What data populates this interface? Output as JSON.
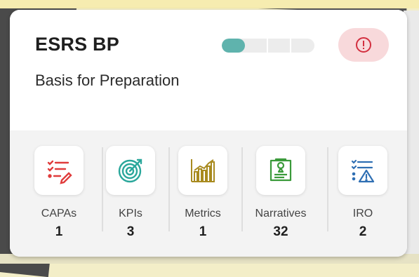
{
  "card": {
    "title": "ESRS BP",
    "subtitle": "Basis for Preparation",
    "progress": {
      "fraction": 0.25,
      "segments": 4
    },
    "alert_icon": "exclamation-circle-icon"
  },
  "tiles": [
    {
      "label": "CAPAs",
      "count": "1",
      "icon": "checklist-pencil-icon",
      "color": "#e03c3c"
    },
    {
      "label": "KPIs",
      "count": "3",
      "icon": "target-icon",
      "color": "#2aa79b"
    },
    {
      "label": "Metrics",
      "count": "1",
      "icon": "bar-chart-icon",
      "color": "#a88a1f"
    },
    {
      "label": "Narratives",
      "count": "32",
      "icon": "document-edit-icon",
      "color": "#3a9a3a"
    },
    {
      "label": "IRO",
      "count": "2",
      "icon": "list-warning-icon",
      "color": "#2f6fb3"
    }
  ],
  "colors": {
    "accent": "#5fb3ad",
    "alert_bg": "#f8d9db",
    "alert": "#d32f3f"
  }
}
